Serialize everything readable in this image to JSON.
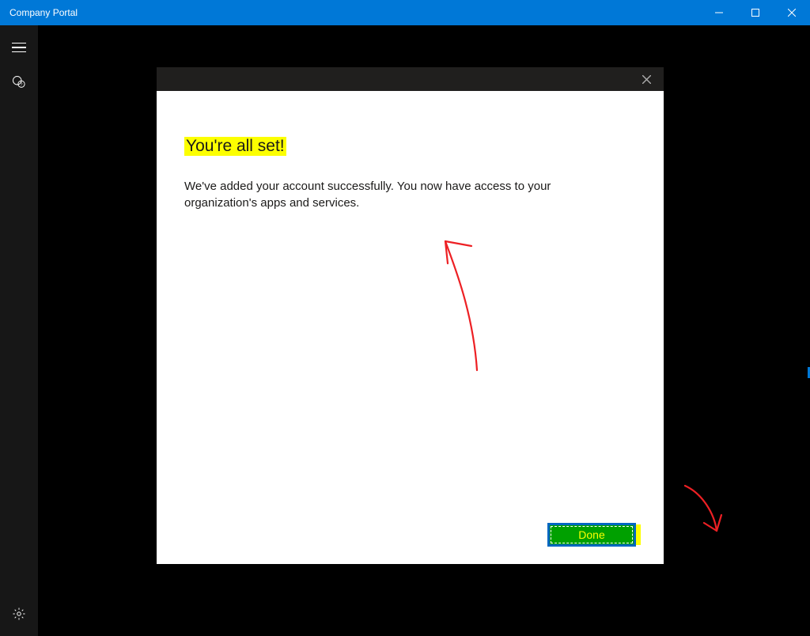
{
  "window": {
    "title": "Company Portal"
  },
  "dialog": {
    "heading": "You're all set!",
    "message": "We've added your account successfully. You now have access to your organization's apps and services.",
    "done_label": "Done"
  }
}
